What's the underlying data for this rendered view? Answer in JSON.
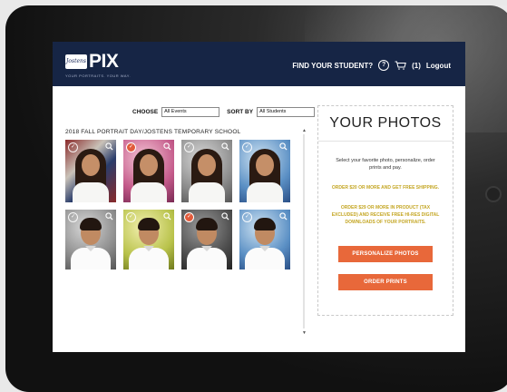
{
  "header": {
    "logo_badge": "Jostens",
    "logo_word": "PIX",
    "logo_tagline": "YOUR PORTRAITS. YOUR WAY.",
    "find_student_label": "FIND YOUR STUDENT?",
    "help_icon": "question-circle-icon",
    "help_glyph": "?",
    "cart_icon": "cart-icon",
    "cart_count": "(1)",
    "logout_label": "Logout"
  },
  "filters": {
    "choose_label": "CHOOSE",
    "choose_value": "All Events",
    "sort_label": "SORT BY",
    "sort_value": "All Students"
  },
  "event_title": "2018 FALL PORTRAIT DAY/JOSTENS TEMPORARY SCHOOL",
  "photos": [
    {
      "subject": "girl",
      "background": "flag",
      "selected": false
    },
    {
      "subject": "girl",
      "background": "pink",
      "selected": true
    },
    {
      "subject": "girl",
      "background": "gray",
      "selected": false
    },
    {
      "subject": "girl",
      "background": "blue",
      "selected": false
    },
    {
      "subject": "boy",
      "background": "gray",
      "selected": false
    },
    {
      "subject": "boy",
      "background": "yellow",
      "selected": false
    },
    {
      "subject": "boy",
      "background": "dark-gray",
      "selected": true
    },
    {
      "subject": "boy",
      "background": "blue",
      "selected": false
    }
  ],
  "panel": {
    "title": "YOUR PHOTOS",
    "description": "Select your favorite photo, personalize, order prints and pay.",
    "promo_shipping": "ORDER $20 OR MORE AND GET FREE SHIPPING.",
    "promo_download": "ORDER $29 OR MORE IN PRODUCT (TAX EXCLUDED) AND RECEIVE FREE HI-RES DIGITAL DOWNLOADS OF YOUR PORTRAITS.",
    "personalize_label": "PERSONALIZE PHOTOS",
    "order_label": "ORDER PRINTS"
  },
  "colors": {
    "header_bg": "#162545",
    "accent_button": "#e8683a",
    "promo_text": "#c4a623",
    "selected_check": "#e25b3c"
  }
}
